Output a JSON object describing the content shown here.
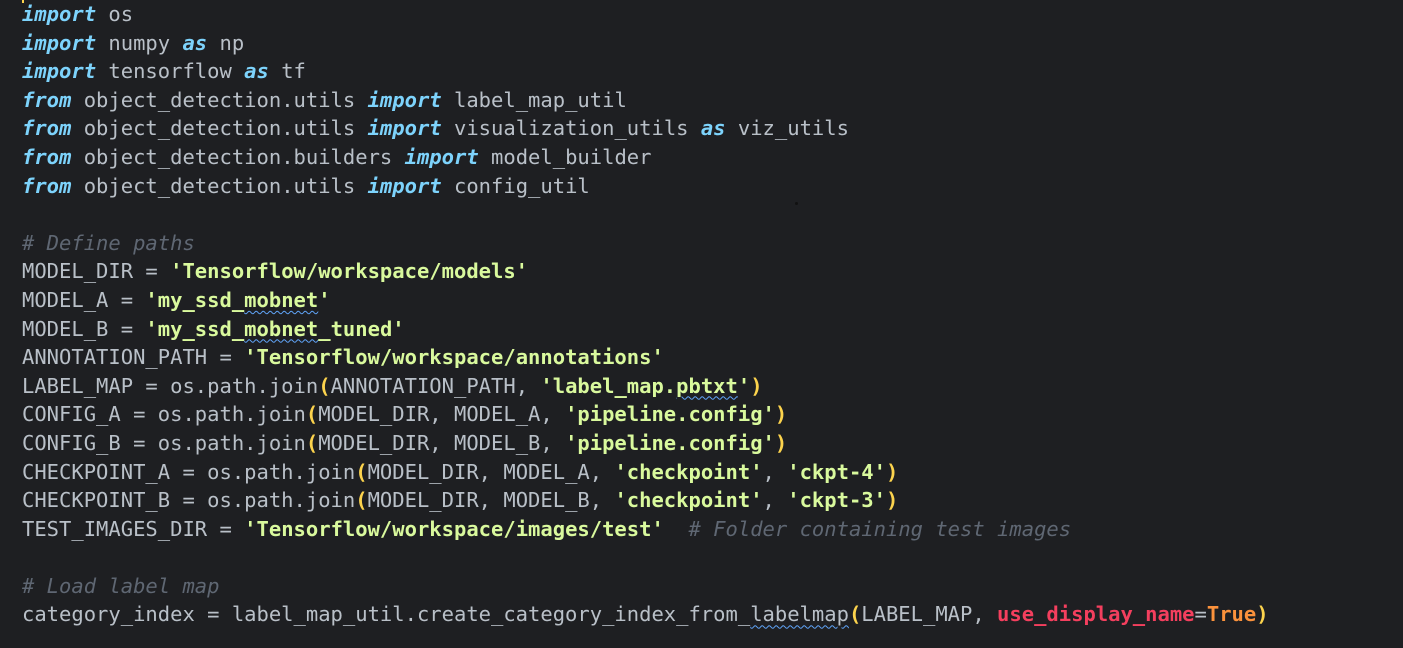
{
  "editor": {
    "lines": [
      {
        "segments": [
          {
            "t": "kw",
            "v": "import"
          },
          {
            "t": "id",
            "v": " os"
          }
        ]
      },
      {
        "segments": [
          {
            "t": "kw",
            "v": "import"
          },
          {
            "t": "id",
            "v": " numpy "
          },
          {
            "t": "kw",
            "v": "as"
          },
          {
            "t": "id",
            "v": " np"
          }
        ]
      },
      {
        "segments": [
          {
            "t": "kw",
            "v": "import"
          },
          {
            "t": "id",
            "v": " tensorflow "
          },
          {
            "t": "kw",
            "v": "as"
          },
          {
            "t": "id",
            "v": " tf"
          }
        ]
      },
      {
        "segments": [
          {
            "t": "kw",
            "v": "from"
          },
          {
            "t": "id",
            "v": " object_detection.utils "
          },
          {
            "t": "kw",
            "v": "import"
          },
          {
            "t": "id",
            "v": " label_map_util"
          }
        ]
      },
      {
        "segments": [
          {
            "t": "kw",
            "v": "from"
          },
          {
            "t": "id",
            "v": " object_detection.utils "
          },
          {
            "t": "kw",
            "v": "import"
          },
          {
            "t": "id",
            "v": " visualization_utils "
          },
          {
            "t": "kw",
            "v": "as"
          },
          {
            "t": "id",
            "v": " viz_utils"
          }
        ]
      },
      {
        "segments": [
          {
            "t": "kw",
            "v": "from"
          },
          {
            "t": "id",
            "v": " object_detection.builders "
          },
          {
            "t": "kw",
            "v": "import"
          },
          {
            "t": "id",
            "v": " model_builder"
          }
        ]
      },
      {
        "segments": [
          {
            "t": "kw",
            "v": "from"
          },
          {
            "t": "id",
            "v": " object_detection.utils "
          },
          {
            "t": "kw",
            "v": "import"
          },
          {
            "t": "id",
            "v": " config_util"
          }
        ]
      },
      {
        "segments": []
      },
      {
        "segments": [
          {
            "t": "cmt",
            "v": "# Define paths"
          }
        ]
      },
      {
        "segments": [
          {
            "t": "id",
            "v": "MODEL_DIR = "
          },
          {
            "t": "str",
            "v": "'Tensorflow/workspace/models'"
          }
        ]
      },
      {
        "segments": [
          {
            "t": "id",
            "v": "MODEL_A = "
          },
          {
            "t": "str",
            "v": "'my_ssd_"
          },
          {
            "t": "str squig",
            "v": "mobnet"
          },
          {
            "t": "str",
            "v": "'"
          }
        ]
      },
      {
        "segments": [
          {
            "t": "id",
            "v": "MODEL_B = "
          },
          {
            "t": "str",
            "v": "'my_ssd_"
          },
          {
            "t": "str squig",
            "v": "mobnet"
          },
          {
            "t": "str",
            "v": "_tuned'"
          }
        ]
      },
      {
        "segments": [
          {
            "t": "id",
            "v": "ANNOTATION_PATH = "
          },
          {
            "t": "str",
            "v": "'Tensorflow/workspace/annotations'"
          }
        ]
      },
      {
        "segments": [
          {
            "t": "id",
            "v": "LABEL_MAP = os.path.join"
          },
          {
            "t": "paren",
            "v": "("
          },
          {
            "t": "id",
            "v": "ANNOTATION_PATH, "
          },
          {
            "t": "str",
            "v": "'label_map."
          },
          {
            "t": "str squig",
            "v": "pbtxt"
          },
          {
            "t": "str",
            "v": "'"
          },
          {
            "t": "paren",
            "v": ")"
          }
        ]
      },
      {
        "segments": [
          {
            "t": "id",
            "v": "CONFIG_A = os.path.join"
          },
          {
            "t": "paren",
            "v": "("
          },
          {
            "t": "id",
            "v": "MODEL_DIR, MODEL_A, "
          },
          {
            "t": "str",
            "v": "'pipeline.config'"
          },
          {
            "t": "paren",
            "v": ")"
          }
        ]
      },
      {
        "segments": [
          {
            "t": "id",
            "v": "CONFIG_B = os.path.join"
          },
          {
            "t": "paren",
            "v": "("
          },
          {
            "t": "id",
            "v": "MODEL_DIR, MODEL_B, "
          },
          {
            "t": "str",
            "v": "'pipeline.config'"
          },
          {
            "t": "paren",
            "v": ")"
          }
        ]
      },
      {
        "segments": [
          {
            "t": "id",
            "v": "CHECKPOINT_A = os.path.join"
          },
          {
            "t": "paren",
            "v": "("
          },
          {
            "t": "id",
            "v": "MODEL_DIR, MODEL_A, "
          },
          {
            "t": "str",
            "v": "'checkpoint'"
          },
          {
            "t": "id",
            "v": ", "
          },
          {
            "t": "str",
            "v": "'ckpt-4'"
          },
          {
            "t": "paren",
            "v": ")"
          }
        ]
      },
      {
        "segments": [
          {
            "t": "id",
            "v": "CHECKPOINT_B = os.path.join"
          },
          {
            "t": "paren",
            "v": "("
          },
          {
            "t": "id",
            "v": "MODEL_DIR, MODEL_B, "
          },
          {
            "t": "str",
            "v": "'checkpoint'"
          },
          {
            "t": "id",
            "v": ", "
          },
          {
            "t": "str",
            "v": "'ckpt-3'"
          },
          {
            "t": "paren",
            "v": ")"
          }
        ]
      },
      {
        "segments": [
          {
            "t": "id",
            "v": "TEST_IMAGES_DIR = "
          },
          {
            "t": "str",
            "v": "'Tensorflow/workspace/images/test'"
          },
          {
            "t": "id",
            "v": "  "
          },
          {
            "t": "cmt",
            "v": "# Folder containing test images"
          }
        ]
      },
      {
        "segments": []
      },
      {
        "segments": [
          {
            "t": "cmt",
            "v": "# Load label map"
          }
        ]
      },
      {
        "segments": [
          {
            "t": "id",
            "v": "category_index = label_map_util.create_category_index_from_"
          },
          {
            "t": "id squig",
            "v": "labelmap"
          },
          {
            "t": "paren",
            "v": "("
          },
          {
            "t": "id",
            "v": "LABEL_MAP, "
          },
          {
            "t": "param",
            "v": "use_display_name"
          },
          {
            "t": "id",
            "v": "="
          },
          {
            "t": "bool",
            "v": "True"
          },
          {
            "t": "paren",
            "v": ")"
          }
        ]
      }
    ]
  }
}
